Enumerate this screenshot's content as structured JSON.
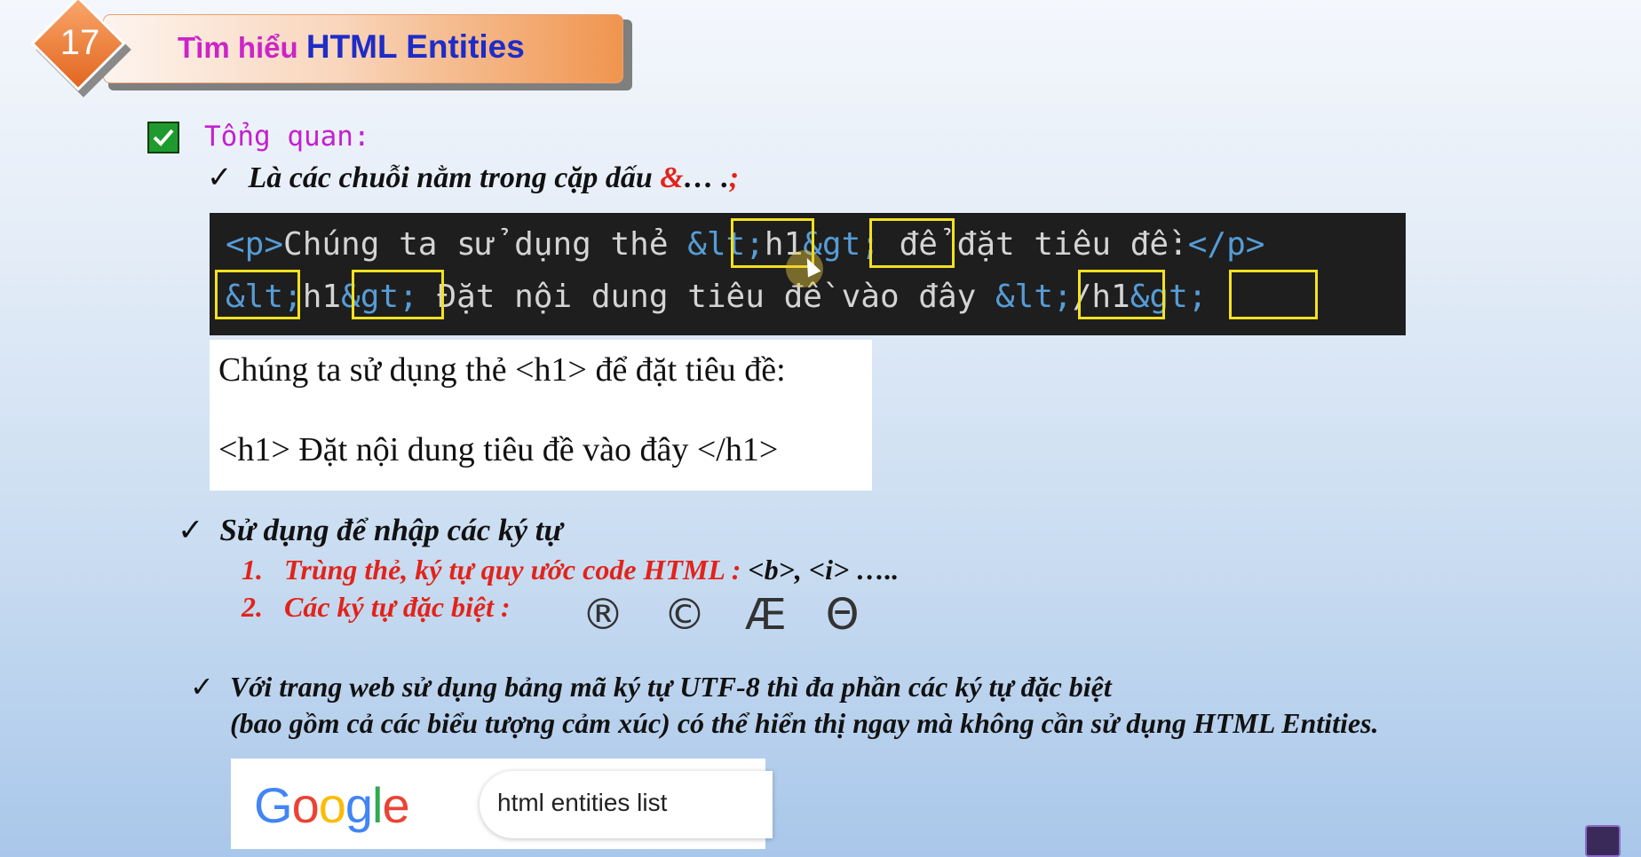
{
  "header": {
    "badge_number": "17",
    "title_part1": "Tìm hiểu ",
    "title_part2": "HTML Entities"
  },
  "section": {
    "title": "Tổng quan:"
  },
  "bullet1": {
    "text": "Là các chuỗi nằm trong cặp dấu ",
    "amp": "&",
    "dots": "… .",
    "semi": ";"
  },
  "code": {
    "line1_p_open": "<p>",
    "line1_text": "Chúng ta sử dụng thẻ ",
    "line1_lt": "&lt;",
    "line1_h1": "h1",
    "line1_gt": "&gt;",
    "line1_rest": " để đặt tiêu đề:",
    "line1_p_close": "</p>",
    "line2_lt": "&lt;",
    "line2_h1": "h1",
    "line2_gt": "&gt;",
    "line2_text": " Đặt nội dung tiêu đề vào đây ",
    "line2_lt2": "&lt;",
    "line2_h1close": "/h1",
    "line2_gt2": "&gt;"
  },
  "rendered": {
    "line1": "Chúng ta sử dụng thẻ <h1> để đặt tiêu đề:",
    "line2": "<h1> Đặt nội dung tiêu đề vào đây </h1>"
  },
  "bullet2": {
    "text": "Sử dụng để nhập các ký tự",
    "item1_num": "1.",
    "item1_text": "Trùng thẻ,  ký tự quy ước code HTML : ",
    "item1_examples": "<b>, <i> …..",
    "item2_num": "2.",
    "item2_text": "Các ký tự đặc biệt :",
    "special_chars": [
      "®",
      "©",
      "Æ",
      "Θ"
    ]
  },
  "bullet3": {
    "line1": "Với trang web sử dụng bảng mã ký tự UTF-8 thì đa phần các ký tự đặc biệt",
    "line2": "(bao gồm cả các biểu tượng cảm xúc) có thể hiển thị ngay mà không cần sử dụng HTML Entities."
  },
  "google": {
    "logo_letters": [
      "G",
      "o",
      "o",
      "g",
      "l",
      "e"
    ],
    "logo_colors": [
      "#4285f4",
      "#ea4335",
      "#fbbc05",
      "#4285f4",
      "#34a853",
      "#ea4335"
    ],
    "search_query": "html entities list"
  },
  "icons": {
    "check": "checkmark-icon",
    "cursor": "mouse-cursor-icon"
  }
}
